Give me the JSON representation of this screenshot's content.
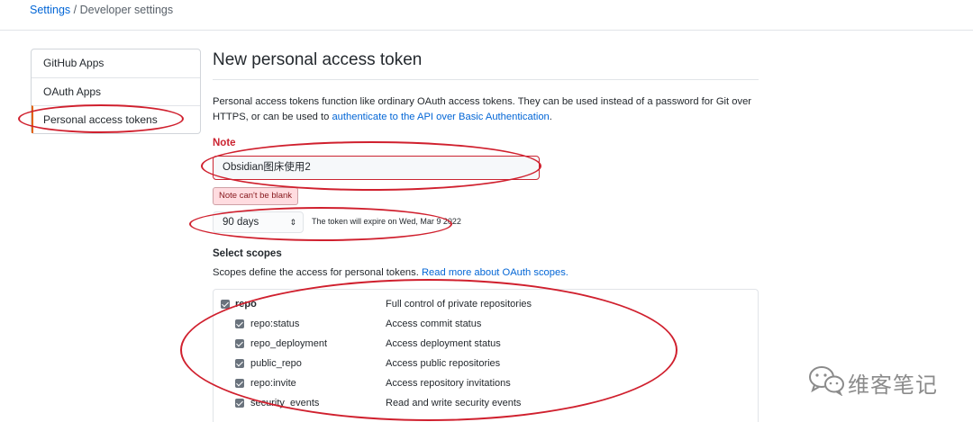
{
  "breadcrumb": {
    "root": "Settings",
    "separator": " / ",
    "current": "Developer settings"
  },
  "sidebar": {
    "items": [
      {
        "label": "GitHub Apps"
      },
      {
        "label": "OAuth Apps"
      },
      {
        "label": "Personal access tokens",
        "active": true
      }
    ]
  },
  "main": {
    "title": "New personal access token",
    "intro_text": "Personal access tokens function like ordinary OAuth access tokens. They can be used instead of a password for Git over HTTPS, or can be used to ",
    "intro_link": "authenticate to the API over Basic Authentication",
    "intro_end": "."
  },
  "note": {
    "label": "Note",
    "value": "Obsidian图床使用2",
    "error": "Note can't be blank"
  },
  "expiration": {
    "selected": "90 days",
    "info": "The token will expire on Wed, Mar 9 2022"
  },
  "scopes": {
    "title": "Select scopes",
    "desc_text": "Scopes define the access for personal tokens. ",
    "desc_link": "Read more about OAuth scopes.",
    "items": [
      {
        "name": "repo",
        "desc": "Full control of private repositories",
        "checked": true
      },
      {
        "name": "repo:status",
        "desc": "Access commit status",
        "checked": true
      },
      {
        "name": "repo_deployment",
        "desc": "Access deployment status",
        "checked": true
      },
      {
        "name": "public_repo",
        "desc": "Access public repositories",
        "checked": true
      },
      {
        "name": "repo:invite",
        "desc": "Access repository invitations",
        "checked": true
      },
      {
        "name": "security_events",
        "desc": "Read and write security events",
        "checked": true
      }
    ]
  },
  "annotation_color": "#d0202e",
  "watermark": {
    "text": "维客笔记",
    "icon": "wechat-icon"
  }
}
